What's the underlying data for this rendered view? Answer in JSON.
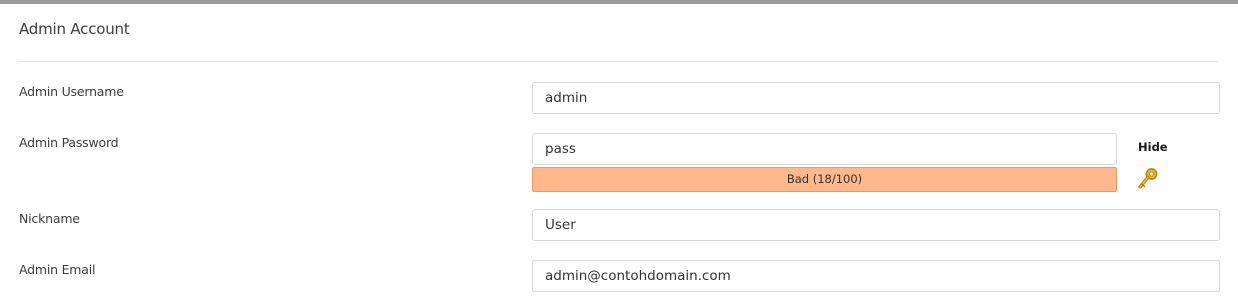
{
  "section": {
    "title": "Admin Account"
  },
  "fields": {
    "username": {
      "label": "Admin Username",
      "value": "admin"
    },
    "password": {
      "label": "Admin Password",
      "value": "pass",
      "toggle_label": "Hide",
      "strength_text": "Bad (18/100)",
      "strength_score": 18,
      "strength_color": "#ffb78c"
    },
    "nickname": {
      "label": "Nickname",
      "value": "User"
    },
    "email": {
      "label": "Admin Email",
      "value": "admin@contohdomain.com"
    }
  },
  "icons": {
    "generate_password": "key-icon"
  }
}
